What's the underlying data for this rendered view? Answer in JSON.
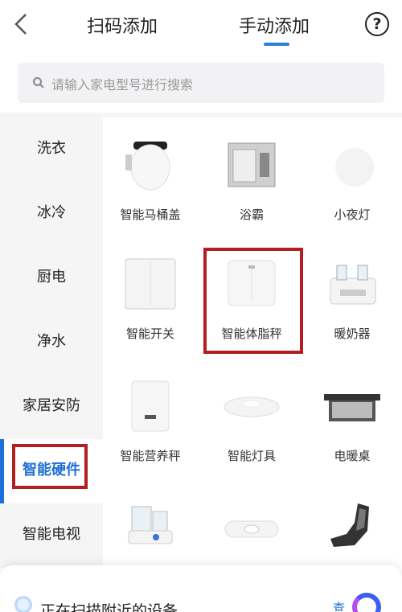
{
  "header": {
    "tab_scan": "扫码添加",
    "tab_manual": "手动添加",
    "help": "?"
  },
  "search": {
    "placeholder": "请输入家电型号进行搜索"
  },
  "sidebar": {
    "items": [
      {
        "label": "洗衣"
      },
      {
        "label": "冰冷"
      },
      {
        "label": "厨电"
      },
      {
        "label": "净水"
      },
      {
        "label": "家居安防"
      },
      {
        "label": "智能硬件"
      },
      {
        "label": "智能电视"
      }
    ],
    "active": "智能硬件"
  },
  "grid": {
    "items": [
      {
        "label": "智能马桶盖",
        "icon": "smart-toilet-lid-icon"
      },
      {
        "label": "浴霸",
        "icon": "bath-heater-icon"
      },
      {
        "label": "小夜灯",
        "icon": "night-light-icon"
      },
      {
        "label": "智能开关",
        "icon": "smart-switch-icon"
      },
      {
        "label": "智能体脂秤",
        "icon": "body-fat-scale-icon"
      },
      {
        "label": "暖奶器",
        "icon": "milk-warmer-icon"
      },
      {
        "label": "智能营养秤",
        "icon": "nutrition-scale-icon"
      },
      {
        "label": "智能灯具",
        "icon": "smart-lamp-icon"
      },
      {
        "label": "电暖桌",
        "icon": "electric-heating-table-icon"
      },
      {
        "label": "",
        "icon": "food-processor-icon"
      },
      {
        "label": "",
        "icon": "heating-belt-icon"
      },
      {
        "label": "",
        "icon": "massage-chair-icon"
      }
    ]
  },
  "scan_bar": {
    "text": "正在扫描附近的设备",
    "action": "查"
  },
  "colors": {
    "accent": "#1d6fd9",
    "highlight_box": "#b31e22"
  }
}
